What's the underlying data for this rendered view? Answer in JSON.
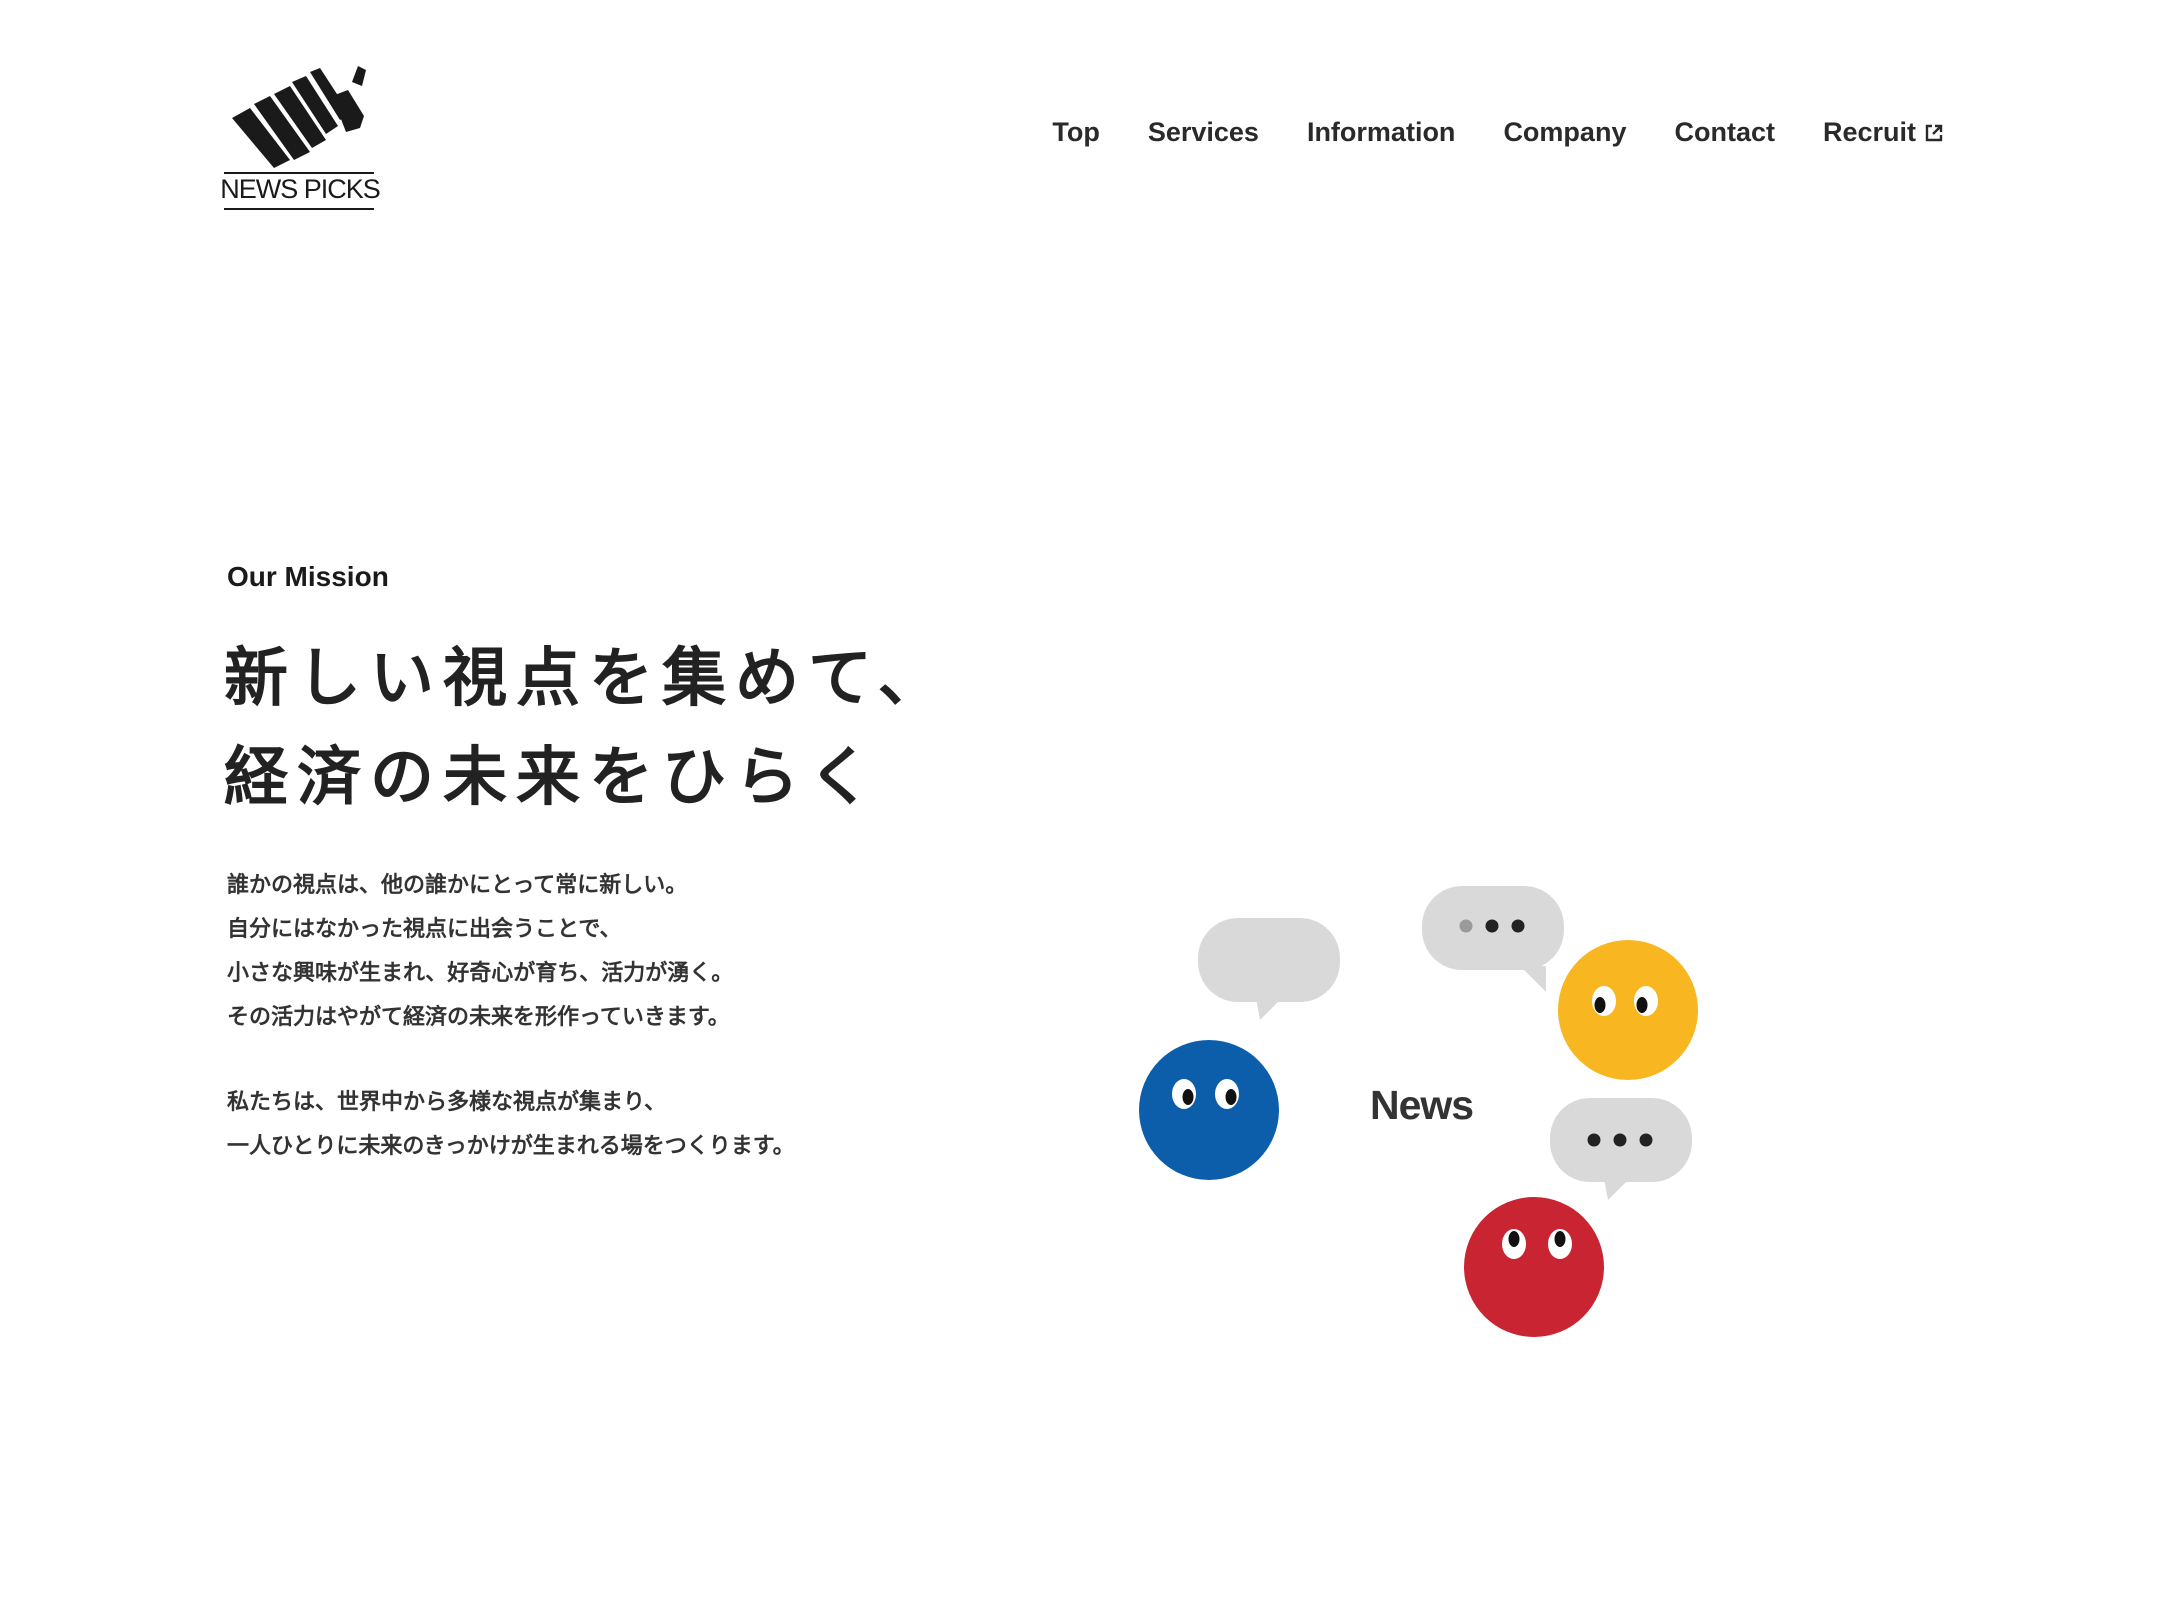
{
  "header": {
    "logo_text": "NEWS PICKS",
    "nav": [
      {
        "label": "Top"
      },
      {
        "label": "Services"
      },
      {
        "label": "Information"
      },
      {
        "label": "Company"
      },
      {
        "label": "Contact"
      },
      {
        "label": "Recruit",
        "icon": "external-link-icon"
      }
    ]
  },
  "mission": {
    "label": "Our Mission",
    "headline": [
      "新しい視点を集めて、",
      "経済の未来をひらく"
    ],
    "paragraphs": [
      [
        "誰かの視点は、他の誰かにとって常に新しい。",
        "自分にはなかった視点に出会うことで、",
        "小さな興味が生まれ、好奇心が育ち、活力が湧く。",
        "その活力はやがて経済の未来を形作っていきます。"
      ],
      [
        "私たちは、世界中から多様な視点が集まり、",
        "一人ひとりに未来のきっかけが生まれる場をつくります。"
      ]
    ]
  },
  "illustration": {
    "center_text": "News",
    "colors": {
      "blue": "#0c5eab",
      "yellow": "#f8b620",
      "red": "#c92431",
      "bubble": "#d9d9d9"
    }
  }
}
